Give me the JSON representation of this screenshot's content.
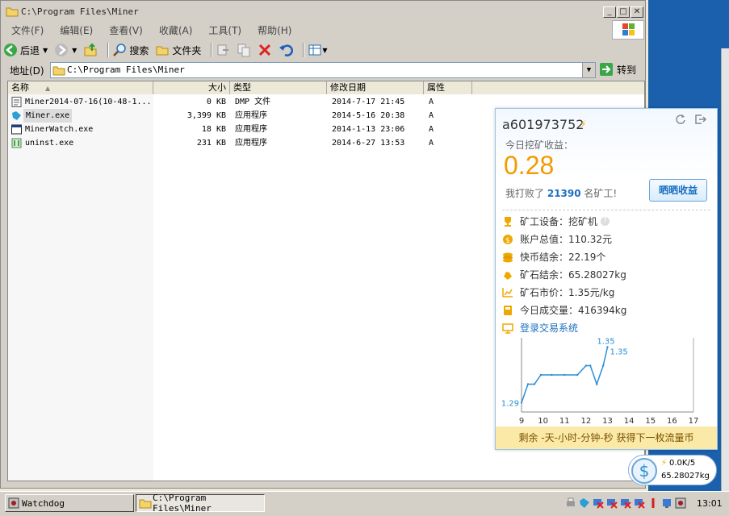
{
  "window": {
    "title": "C:\\Program Files\\Miner",
    "menu": [
      "文件(F)",
      "编辑(E)",
      "查看(V)",
      "收藏(A)",
      "工具(T)",
      "帮助(H)"
    ],
    "toolbar": {
      "back": "后退",
      "search": "搜索",
      "folders": "文件夹"
    },
    "address_label": "地址(D)",
    "address_value": "C:\\Program Files\\Miner",
    "go_label": "转到",
    "columns": [
      "名称",
      "大小",
      "类型",
      "修改日期",
      "属性"
    ],
    "files": [
      {
        "name": "Miner2014-07-16(10-48-1...",
        "size": "0 KB",
        "type": "DMP 文件",
        "modified": "2014-7-17 21:45",
        "attr": "A",
        "icon": "file-icon"
      },
      {
        "name": "Miner.exe",
        "size": "3,399 KB",
        "type": "应用程序",
        "modified": "2014-5-16 20:38",
        "attr": "A",
        "icon": "miner-app-icon"
      },
      {
        "name": "MinerWatch.exe",
        "size": "18 KB",
        "type": "应用程序",
        "modified": "2014-1-13 23:06",
        "attr": "A",
        "icon": "window-app-icon"
      },
      {
        "name": "uninst.exe",
        "size": "231 KB",
        "type": "应用程序",
        "modified": "2014-6-27 13:53",
        "attr": "A",
        "icon": "uninstall-icon"
      }
    ]
  },
  "panel": {
    "username": "a601973752",
    "today_label": "今日挖矿收益：",
    "today_value": "0.28",
    "beat_prefix": "我打败了",
    "beat_count": "21390",
    "beat_suffix": "名矿工!",
    "share_button": "晒晒收益",
    "details": [
      {
        "label": "矿工设备：挖矿机",
        "icon": "trophy-icon",
        "color": "#f0a800"
      },
      {
        "label": "账户总值：110.32元",
        "icon": "coin-icon",
        "color": "#f0a800"
      },
      {
        "label": "快币结余：22.19个",
        "icon": "coins-stack-icon",
        "color": "#f0a800"
      },
      {
        "label": "矿石结余：65.28027kg",
        "icon": "ore-icon",
        "color": "#f0a800"
      },
      {
        "label": "矿石市价：1.35元/kg",
        "icon": "trend-icon",
        "color": "#f0a800"
      },
      {
        "label": "今日成交量：416394kg",
        "icon": "volume-icon",
        "color": "#f0a800"
      }
    ],
    "trade_link": "登录交易系统",
    "footer": "剩余 -天-小时-分钟-秒 获得下一枚流量币",
    "speed": "0.0K/5",
    "ore": "65.28027kg",
    "accent": "#f49b00",
    "link_color": "#1a6fc0"
  },
  "chart_data": {
    "type": "line",
    "x_ticks": [
      "9",
      "10",
      "11",
      "12",
      "13",
      "14",
      "15",
      "16",
      "17"
    ],
    "x": [
      9,
      9.3,
      9.6,
      9.9,
      10.4,
      11,
      11.6,
      12,
      12.2,
      12.5,
      12.8,
      13
    ],
    "y": [
      1.29,
      1.31,
      1.31,
      1.32,
      1.32,
      1.32,
      1.32,
      1.33,
      1.33,
      1.31,
      1.33,
      1.35
    ],
    "xlim": [
      9,
      17
    ],
    "ylim": [
      1.28,
      1.36
    ],
    "min_label": "1.29",
    "max_label": "1.35",
    "last_label": "1.35",
    "color": "#2a8fd6"
  },
  "taskbar": {
    "items": [
      "Watchdog",
      "C:\\Program Files\\Miner"
    ],
    "clock": "13:01"
  }
}
